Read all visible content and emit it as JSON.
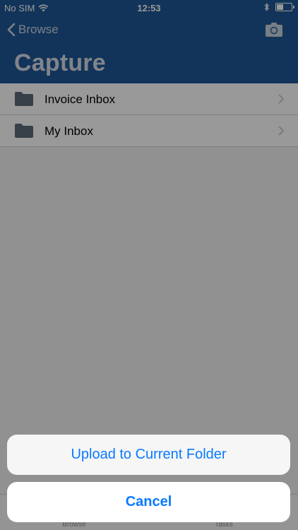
{
  "status_bar": {
    "carrier": "No SIM",
    "time": "12:53",
    "battery_level": 0.45
  },
  "nav": {
    "back_label": "Browse",
    "title": "Capture"
  },
  "list": {
    "items": [
      {
        "label": "Invoice Inbox",
        "icon": "folder-icon"
      },
      {
        "label": "My Inbox",
        "icon": "folder-icon"
      }
    ]
  },
  "tab_bar": {
    "items": [
      {
        "label": "Browse"
      },
      {
        "label": "Tasks"
      }
    ]
  },
  "action_sheet": {
    "action_label": "Upload to Current Folder",
    "cancel_label": "Cancel"
  },
  "colors": {
    "header_bg": "#1f5796",
    "accent": "#0a7aff"
  }
}
